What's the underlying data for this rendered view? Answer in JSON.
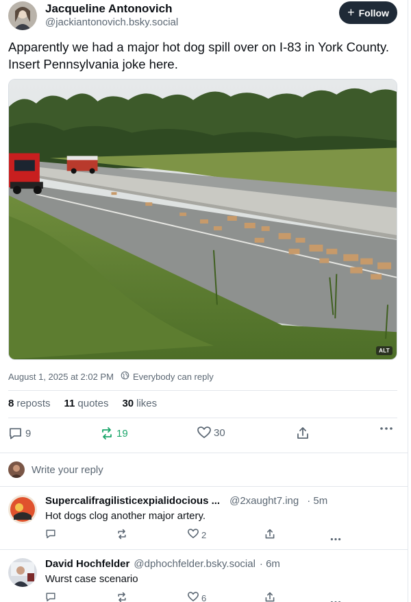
{
  "post": {
    "author_name": "Jacqueline Antonovich",
    "author_handle": "@jackiantonovich.bsky.social",
    "follow_label": "Follow",
    "text": "Apparently we had a major hot dog spill over on I-83 in York County. Insert Pennsylvania joke here.",
    "alt_badge": "ALT",
    "timestamp": "August 1, 2025 at 2:02 PM",
    "reply_setting": "Everybody can reply",
    "stats": {
      "reposts_count": "8",
      "reposts_label": "reposts",
      "quotes_count": "11",
      "quotes_label": "quotes",
      "likes_count": "30",
      "likes_label": "likes"
    },
    "actions": {
      "replies": "9",
      "reposts": "19",
      "likes": "30"
    }
  },
  "composer": {
    "placeholder": "Write your reply"
  },
  "replies": [
    {
      "name": "Supercalifragilisticexpialidocious ...",
      "handle": "@2xaught7.ing",
      "time": "· 5m",
      "text": "Hot dogs clog another major artery.",
      "likes": "2"
    },
    {
      "name": "David Hochfelder",
      "handle": "@dphochfelder.bsky.social",
      "time": "· 6m",
      "text": "Wurst case scenario",
      "likes": "6"
    }
  ],
  "colors": {
    "accent_follow": "#1f2a37",
    "repost_active": "#1aa56a",
    "muted": "#5b6773"
  },
  "icons": [
    "plus-icon",
    "globe-icon",
    "reply-icon",
    "repost-icon",
    "heart-icon",
    "share-icon",
    "more-icon"
  ]
}
